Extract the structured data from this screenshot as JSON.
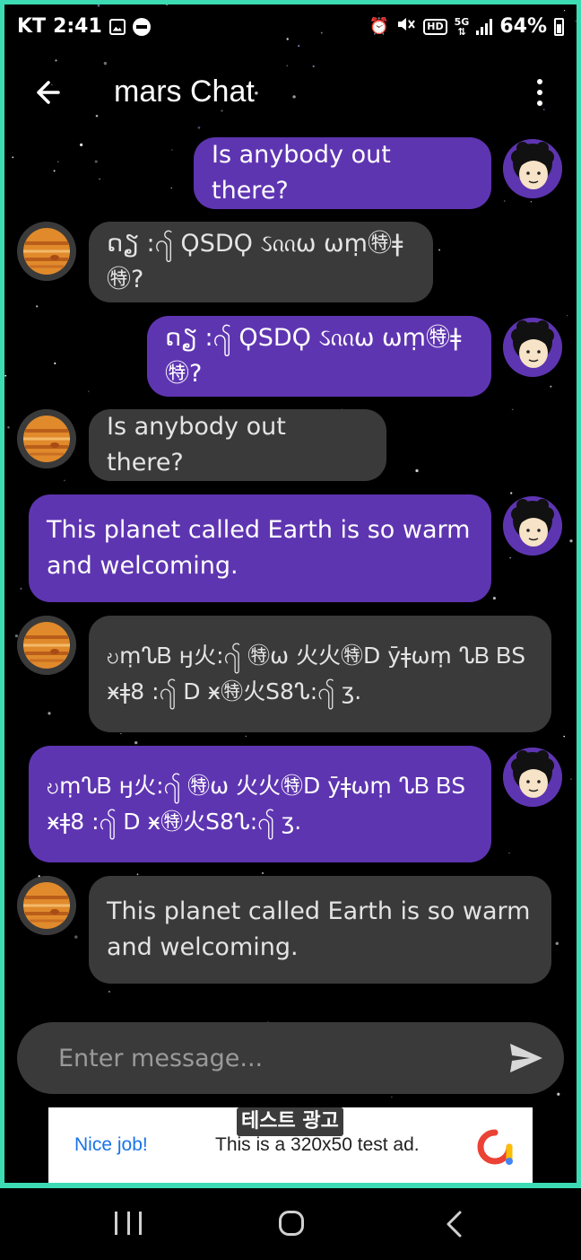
{
  "status_bar": {
    "carrier": "KT",
    "time": "2:41",
    "battery": "64%",
    "icons": [
      "gallery-icon",
      "dnd-icon",
      "alarm-icon",
      "mute-icon",
      "hd-icon",
      "5g-icon",
      "signal-icon",
      "battery-icon"
    ]
  },
  "app_bar": {
    "title": "mars Chat",
    "back_icon": "arrow-left-icon",
    "menu_icon": "more-vertical-icon"
  },
  "messages": [
    {
      "from": "me",
      "text": "Is anybody out there?"
    },
    {
      "from": "mars",
      "text": "ດຽ ꞉႟ ϘSDϘ ઽᦶω ωṃ㊕ǂ㊕?"
    },
    {
      "from": "me",
      "text": "ດຽ ꞉႟ ϘSDϘ ઽᦶω ωṃ㊕ǂ㊕?"
    },
    {
      "from": "mars",
      "text": "Is anybody out there?"
    },
    {
      "from": "me",
      "text": "This planet called Earth is so warm and welcoming."
    },
    {
      "from": "mars",
      "text": "ဎṃᔐᏴ ӈ⽕꞉႟ ㊕ω ⽕⽕㊕D ȳǂωṃ ᔐᏴ ᏴS ӿǂ8 ꞉႟ D ӿ㊕⽕S8ᔐ꞉႟ ʒ."
    },
    {
      "from": "me",
      "text": "ဎṃᔐᏴ ӈ⽕꞉႟ ㊕ω ⽕⽕㊕D ȳǂωṃ ᔐᏴ ᏴS ӿǂ8 ꞉႟ D ӿ㊕⽕S8ᔐ꞉႟ ʒ."
    },
    {
      "from": "mars",
      "text": "This planet called Earth is so warm and welcoming."
    }
  ],
  "composer": {
    "placeholder": "Enter message...",
    "send_icon": "send-icon"
  },
  "ad": {
    "tag": "테스트 광고",
    "headline": "Nice job!",
    "body": "This is a 320x50 test ad."
  },
  "colors": {
    "accent_frame": "#3ddbb3",
    "sent_bubble": "#5e35b1",
    "received_bubble": "#3a3a3a",
    "background": "#000000"
  },
  "nav_bar": {
    "icons": [
      "recents-icon",
      "home-icon",
      "back-icon"
    ]
  }
}
